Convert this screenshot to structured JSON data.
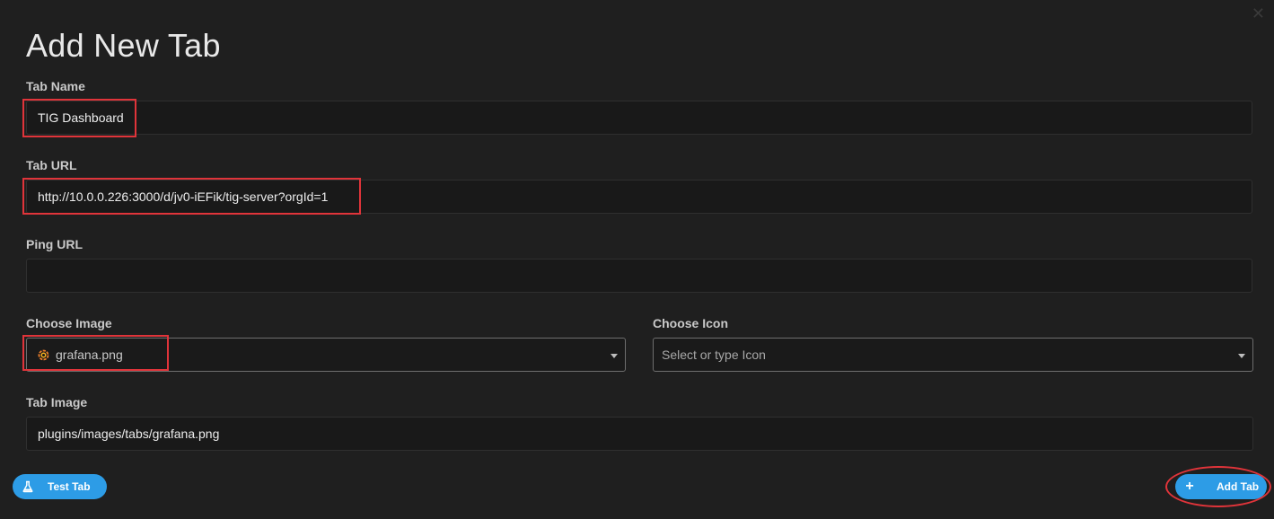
{
  "modal": {
    "title": "Add New Tab",
    "close_icon": "close-icon"
  },
  "fields": {
    "tab_name": {
      "label": "Tab Name",
      "value": "TIG Dashboard"
    },
    "tab_url": {
      "label": "Tab URL",
      "value": "http://10.0.0.226:3000/d/jv0-iEFik/tig-server?orgId=1"
    },
    "ping_url": {
      "label": "Ping URL",
      "value": ""
    },
    "choose_image": {
      "label": "Choose Image",
      "value": "grafana.png",
      "icon": "grafana-icon"
    },
    "choose_icon": {
      "label": "Choose Icon",
      "placeholder": "Select or type Icon"
    },
    "tab_image": {
      "label": "Tab Image",
      "value": "plugins/images/tabs/grafana.png"
    }
  },
  "buttons": {
    "test_tab": {
      "label": "Test Tab",
      "icon": "flask-icon"
    },
    "add_tab": {
      "label": "Add Tab",
      "icon": "plus-icon"
    }
  },
  "colors": {
    "background": "#1f1f1f",
    "accent": "#2d9ce6",
    "highlight": "#e0343a"
  }
}
